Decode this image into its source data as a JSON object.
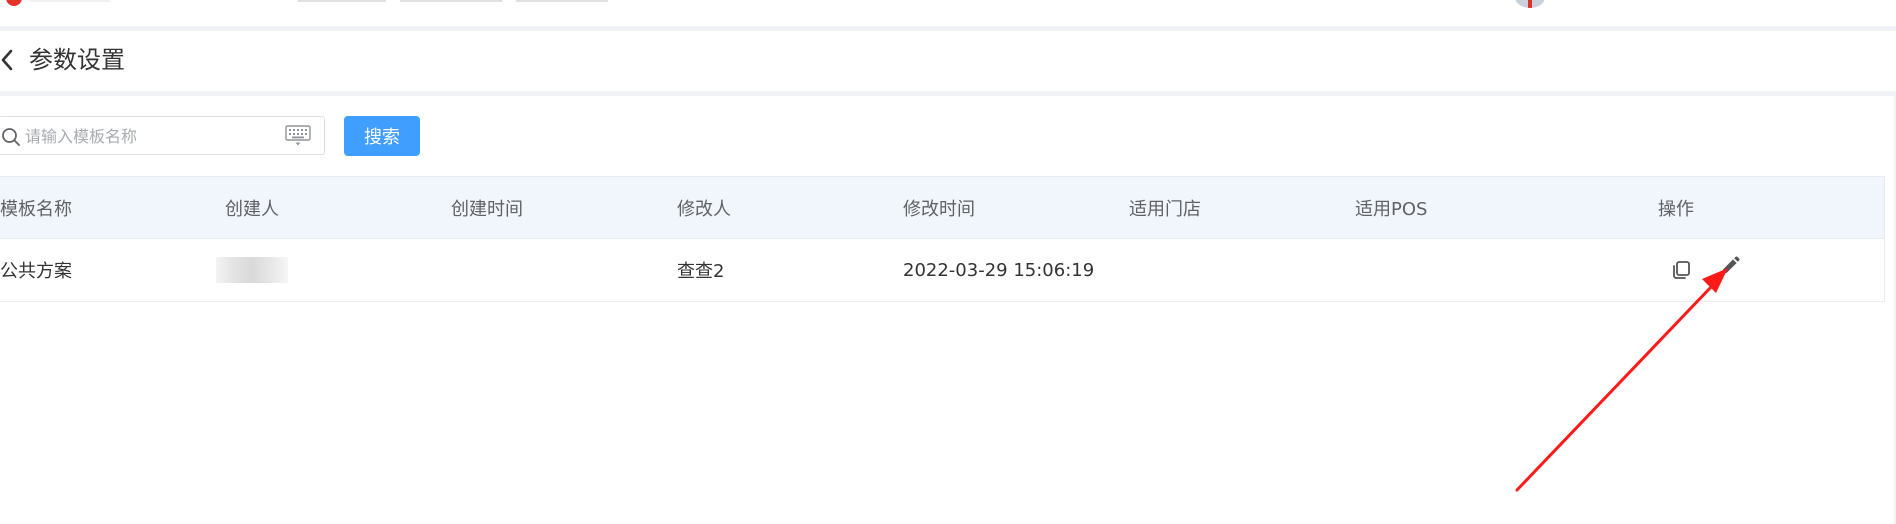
{
  "header": {
    "title": "参数设置"
  },
  "search": {
    "placeholder": "请输入模板名称",
    "button_label": "搜索"
  },
  "table": {
    "columns": [
      "模板名称",
      "创建人",
      "创建时间",
      "修改人",
      "修改时间",
      "适用门店",
      "适用POS",
      "操作"
    ],
    "rows": [
      {
        "name": "公共方案",
        "creator": "",
        "created_at": "",
        "modifier": "查查2",
        "modified_at": "2022-03-29 15:06:19",
        "stores": "",
        "pos": ""
      }
    ]
  },
  "icons": {
    "back": "chevron-left-icon",
    "search": "search-icon",
    "keyboard": "keyboard-icon",
    "copy": "copy-icon",
    "edit": "edit-pencil-icon"
  },
  "colors": {
    "primary": "#409eff",
    "header_row_bg": "#f1f6fc",
    "annotation_arrow": "#ff1a1a",
    "logo": "#e5332a"
  }
}
